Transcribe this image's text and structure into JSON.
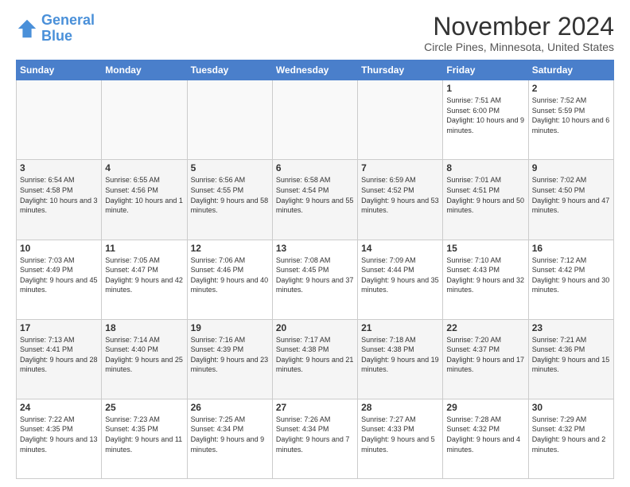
{
  "logo": {
    "line1": "General",
    "line2": "Blue"
  },
  "title": "November 2024",
  "location": "Circle Pines, Minnesota, United States",
  "days_header": [
    "Sunday",
    "Monday",
    "Tuesday",
    "Wednesday",
    "Thursday",
    "Friday",
    "Saturday"
  ],
  "weeks": [
    [
      {
        "day": "",
        "info": ""
      },
      {
        "day": "",
        "info": ""
      },
      {
        "day": "",
        "info": ""
      },
      {
        "day": "",
        "info": ""
      },
      {
        "day": "",
        "info": ""
      },
      {
        "day": "1",
        "info": "Sunrise: 7:51 AM\nSunset: 6:00 PM\nDaylight: 10 hours and 9 minutes."
      },
      {
        "day": "2",
        "info": "Sunrise: 7:52 AM\nSunset: 5:59 PM\nDaylight: 10 hours and 6 minutes."
      }
    ],
    [
      {
        "day": "3",
        "info": "Sunrise: 6:54 AM\nSunset: 4:58 PM\nDaylight: 10 hours and 3 minutes."
      },
      {
        "day": "4",
        "info": "Sunrise: 6:55 AM\nSunset: 4:56 PM\nDaylight: 10 hours and 1 minute."
      },
      {
        "day": "5",
        "info": "Sunrise: 6:56 AM\nSunset: 4:55 PM\nDaylight: 9 hours and 58 minutes."
      },
      {
        "day": "6",
        "info": "Sunrise: 6:58 AM\nSunset: 4:54 PM\nDaylight: 9 hours and 55 minutes."
      },
      {
        "day": "7",
        "info": "Sunrise: 6:59 AM\nSunset: 4:52 PM\nDaylight: 9 hours and 53 minutes."
      },
      {
        "day": "8",
        "info": "Sunrise: 7:01 AM\nSunset: 4:51 PM\nDaylight: 9 hours and 50 minutes."
      },
      {
        "day": "9",
        "info": "Sunrise: 7:02 AM\nSunset: 4:50 PM\nDaylight: 9 hours and 47 minutes."
      }
    ],
    [
      {
        "day": "10",
        "info": "Sunrise: 7:03 AM\nSunset: 4:49 PM\nDaylight: 9 hours and 45 minutes."
      },
      {
        "day": "11",
        "info": "Sunrise: 7:05 AM\nSunset: 4:47 PM\nDaylight: 9 hours and 42 minutes."
      },
      {
        "day": "12",
        "info": "Sunrise: 7:06 AM\nSunset: 4:46 PM\nDaylight: 9 hours and 40 minutes."
      },
      {
        "day": "13",
        "info": "Sunrise: 7:08 AM\nSunset: 4:45 PM\nDaylight: 9 hours and 37 minutes."
      },
      {
        "day": "14",
        "info": "Sunrise: 7:09 AM\nSunset: 4:44 PM\nDaylight: 9 hours and 35 minutes."
      },
      {
        "day": "15",
        "info": "Sunrise: 7:10 AM\nSunset: 4:43 PM\nDaylight: 9 hours and 32 minutes."
      },
      {
        "day": "16",
        "info": "Sunrise: 7:12 AM\nSunset: 4:42 PM\nDaylight: 9 hours and 30 minutes."
      }
    ],
    [
      {
        "day": "17",
        "info": "Sunrise: 7:13 AM\nSunset: 4:41 PM\nDaylight: 9 hours and 28 minutes."
      },
      {
        "day": "18",
        "info": "Sunrise: 7:14 AM\nSunset: 4:40 PM\nDaylight: 9 hours and 25 minutes."
      },
      {
        "day": "19",
        "info": "Sunrise: 7:16 AM\nSunset: 4:39 PM\nDaylight: 9 hours and 23 minutes."
      },
      {
        "day": "20",
        "info": "Sunrise: 7:17 AM\nSunset: 4:38 PM\nDaylight: 9 hours and 21 minutes."
      },
      {
        "day": "21",
        "info": "Sunrise: 7:18 AM\nSunset: 4:38 PM\nDaylight: 9 hours and 19 minutes."
      },
      {
        "day": "22",
        "info": "Sunrise: 7:20 AM\nSunset: 4:37 PM\nDaylight: 9 hours and 17 minutes."
      },
      {
        "day": "23",
        "info": "Sunrise: 7:21 AM\nSunset: 4:36 PM\nDaylight: 9 hours and 15 minutes."
      }
    ],
    [
      {
        "day": "24",
        "info": "Sunrise: 7:22 AM\nSunset: 4:35 PM\nDaylight: 9 hours and 13 minutes."
      },
      {
        "day": "25",
        "info": "Sunrise: 7:23 AM\nSunset: 4:35 PM\nDaylight: 9 hours and 11 minutes."
      },
      {
        "day": "26",
        "info": "Sunrise: 7:25 AM\nSunset: 4:34 PM\nDaylight: 9 hours and 9 minutes."
      },
      {
        "day": "27",
        "info": "Sunrise: 7:26 AM\nSunset: 4:34 PM\nDaylight: 9 hours and 7 minutes."
      },
      {
        "day": "28",
        "info": "Sunrise: 7:27 AM\nSunset: 4:33 PM\nDaylight: 9 hours and 5 minutes."
      },
      {
        "day": "29",
        "info": "Sunrise: 7:28 AM\nSunset: 4:32 PM\nDaylight: 9 hours and 4 minutes."
      },
      {
        "day": "30",
        "info": "Sunrise: 7:29 AM\nSunset: 4:32 PM\nDaylight: 9 hours and 2 minutes."
      }
    ]
  ]
}
